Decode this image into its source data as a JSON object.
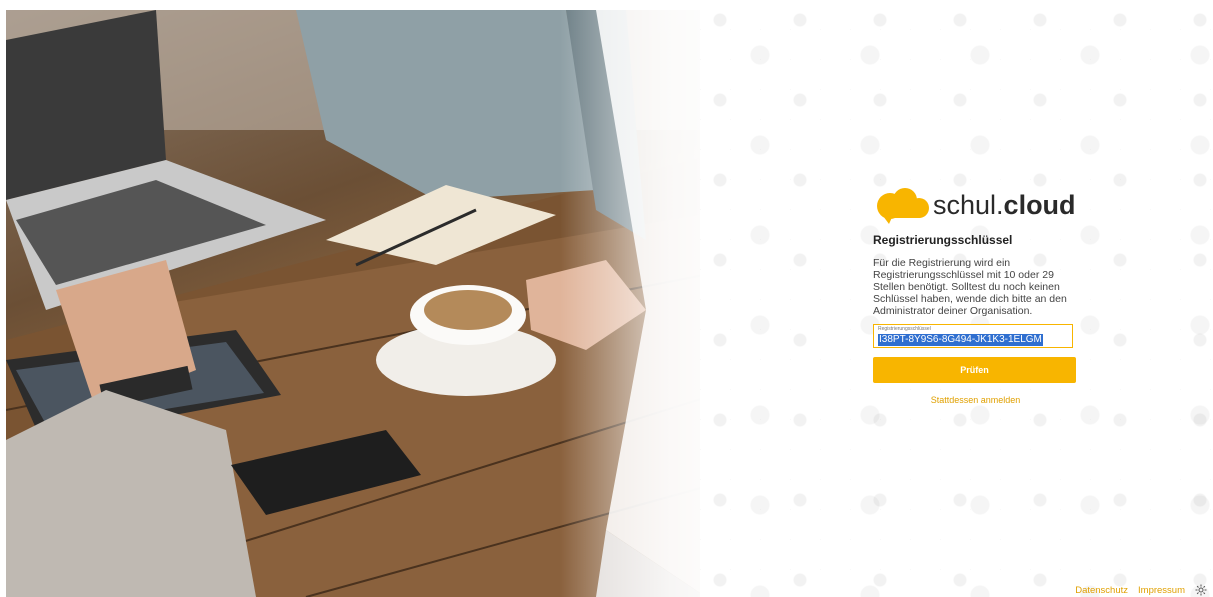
{
  "brand": {
    "name_light": "schul.",
    "name_bold": "cloud",
    "color": "#f8b500"
  },
  "form": {
    "heading": "Registrierungsschlüssel",
    "description": "Für die Registrierung wird ein Registrierungsschlüssel mit 10 oder 29 Stellen benötigt. Solltest du noch keinen Schlüssel haben, wende dich bitte an den Administrator deiner Organisation.",
    "field_label": "Registrierungsschlüssel",
    "field_value": "I38PT-8Y9S6-8G494-JK1K3-1ELGM",
    "submit_label": "Prüfen",
    "alt_link": "Stattdessen anmelden"
  },
  "footer": {
    "links": [
      "Datenschutz",
      "Impressum"
    ],
    "settings_icon": "gear-icon"
  },
  "background": {
    "left_panel": "photo-cafe-table-laptop-coffee",
    "right_panel": "doodle-pattern"
  }
}
